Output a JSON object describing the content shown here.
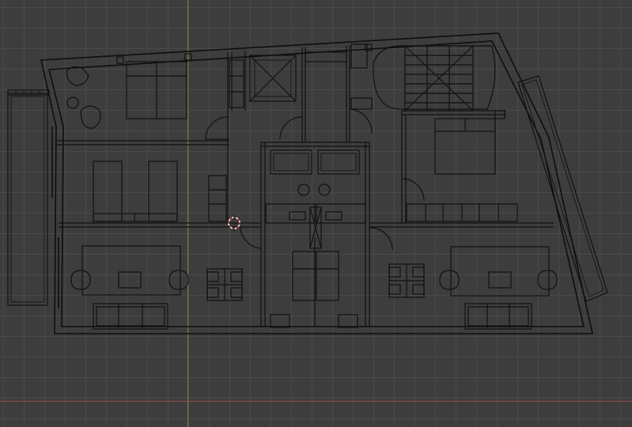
{
  "viewport": {
    "background_color": "#3d3d3d",
    "grid_color": "#4a4a4a",
    "x_axis_color": "#9a4a4a",
    "y_axis_color": "#6f8a3a",
    "cursor_outer_color": "#cf3a3a",
    "cursor_inner_color": "#ffffff",
    "linework_color": "#111111"
  },
  "icons": {
    "cursor": "3d-cursor-icon"
  }
}
